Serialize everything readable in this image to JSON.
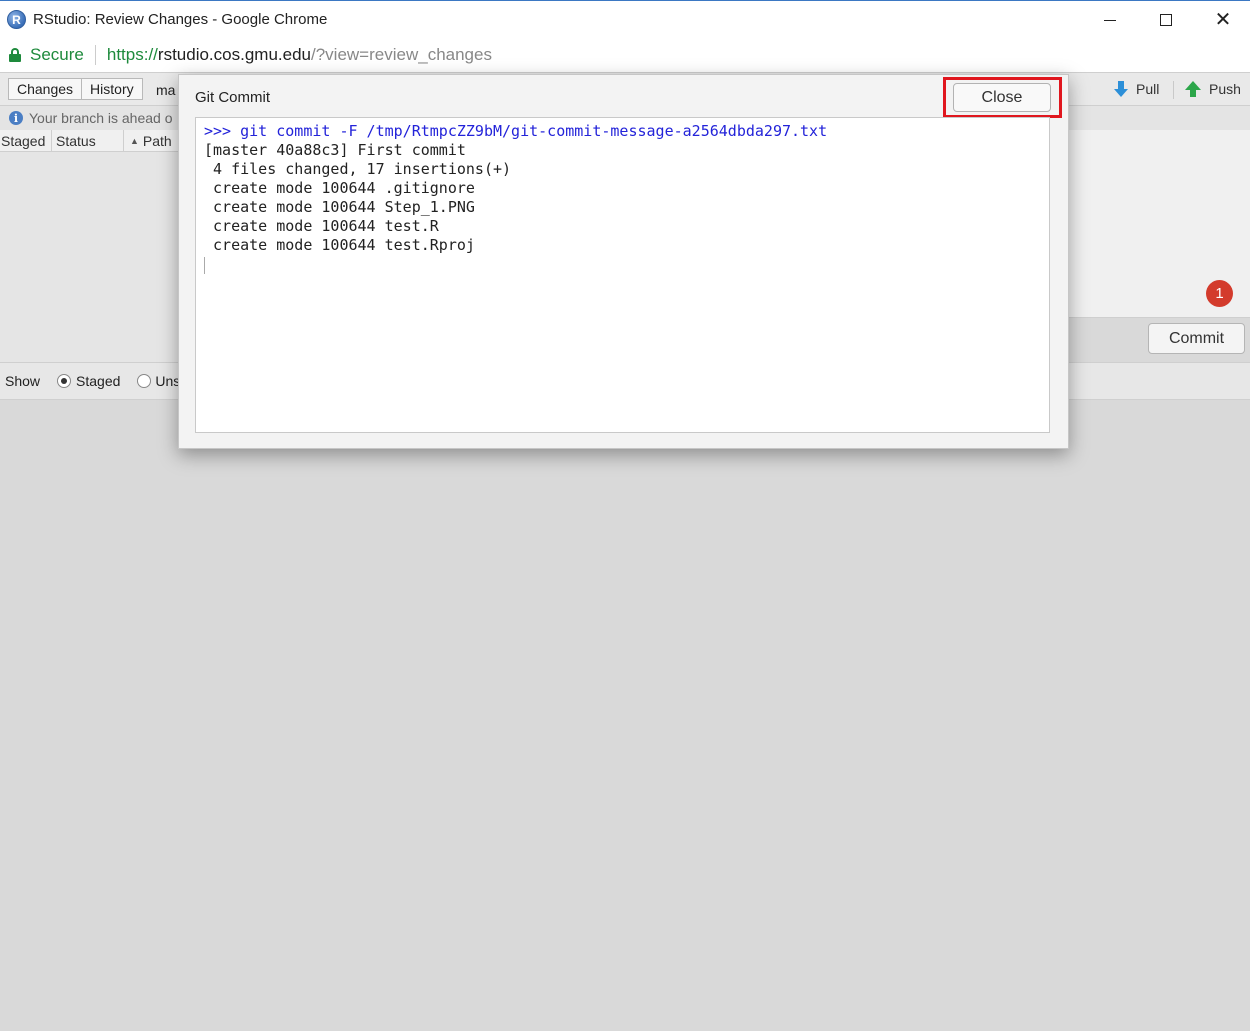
{
  "window": {
    "title": "RStudio: Review Changes - Google Chrome",
    "app_icon_letter": "R"
  },
  "address_bar": {
    "secure_label": "Secure",
    "url_scheme": "https://",
    "url_host": "rstudio.cos.gmu.edu",
    "url_path": "/?view=review_changes"
  },
  "toolbar": {
    "tabs": [
      {
        "label": "Changes"
      },
      {
        "label": "History"
      }
    ],
    "branch_partial": "ma",
    "pull_label": "Pull",
    "push_label": "Push"
  },
  "info_bar": {
    "text": "Your branch is ahead o"
  },
  "file_table": {
    "columns": [
      "Staged",
      "Status",
      "Path"
    ]
  },
  "commit_panel": {
    "badge_count": "1",
    "commit_label": "Commit"
  },
  "show_row": {
    "label": "Show",
    "staged_label": "Staged",
    "unstaged_partial": "Uns"
  },
  "dialog": {
    "title": "Git Commit",
    "close_label": "Close",
    "command_line": ">>> git commit -F /tmp/RtmpcZZ9bM/git-commit-message-a2564dbda297.txt",
    "output_lines": [
      "[master 40a88c3] First commit",
      " 4 files changed, 17 insertions(+)",
      " create mode 100644 .gitignore",
      " create mode 100644 Step_1.PNG",
      " create mode 100644 test.R",
      " create mode 100644 test.Rproj"
    ]
  },
  "colors": {
    "secure_green": "#1e8a3c",
    "command_blue": "#2323d9",
    "highlight_red": "#e0161e",
    "badge_red": "#d33b2c"
  }
}
